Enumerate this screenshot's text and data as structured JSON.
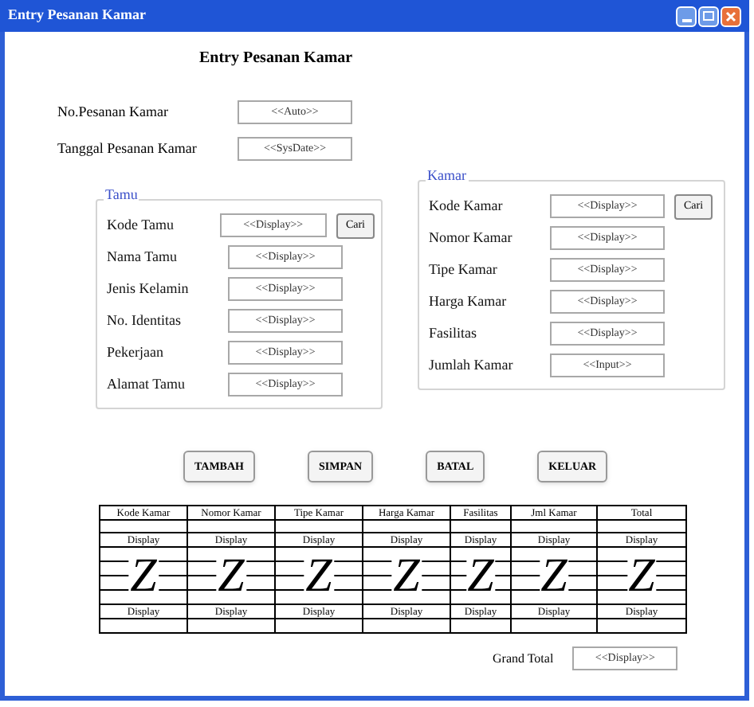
{
  "window": {
    "title": "Entry Pesanan Kamar",
    "controls": [
      {
        "kind": "minimize"
      },
      {
        "kind": "maximize"
      },
      {
        "kind": "close"
      }
    ]
  },
  "heading": "Entry Pesanan Kamar",
  "top_fields": [
    {
      "label": "No.Pesanan Kamar",
      "value": "<<Auto>>"
    },
    {
      "label": "Tanggal Pesanan Kamar",
      "value": "<<SysDate>>"
    }
  ],
  "groups": [
    {
      "title": "Tamu",
      "fields": [
        {
          "label": "Kode Tamu",
          "value": "<<Display>>",
          "button": "Cari"
        },
        {
          "label": "Nama Tamu",
          "value": "<<Display>>"
        },
        {
          "label": "Jenis Kelamin",
          "value": "<<Display>>"
        },
        {
          "label": "No. Identitas",
          "value": "<<Display>>"
        },
        {
          "label": "Pekerjaan",
          "value": "<<Display>>"
        },
        {
          "label": "Alamat Tamu",
          "value": "<<Display>>"
        }
      ]
    },
    {
      "title": "Kamar",
      "fields": [
        {
          "label": "Kode Kamar",
          "value": "<<Display>>",
          "button": "Cari"
        },
        {
          "label": "Nomor Kamar",
          "value": "<<Display>>"
        },
        {
          "label": "Tipe Kamar",
          "value": "<<Display>>"
        },
        {
          "label": "Harga Kamar",
          "value": "<<Display>>"
        },
        {
          "label": "Fasilitas",
          "value": "<<Display>>"
        },
        {
          "label": "Jumlah Kamar",
          "value": "<<Input>>"
        }
      ]
    }
  ],
  "buttons": [
    "TAMBAH",
    "SIMPAN",
    "BATAL",
    "KELUAR"
  ],
  "table": {
    "columns": [
      {
        "header": "Kode Kamar",
        "top": "Display",
        "mark": "Z",
        "bottom": "Display"
      },
      {
        "header": "Nomor Kamar",
        "top": "Display",
        "mark": "Z",
        "bottom": "Display"
      },
      {
        "header": "Tipe Kamar",
        "top": "Display",
        "mark": "Z",
        "bottom": "Display"
      },
      {
        "header": "Harga Kamar",
        "top": "Display",
        "mark": "Z",
        "bottom": "Display"
      },
      {
        "header": "Fasilitas",
        "top": "Display",
        "mark": "Z",
        "bottom": "Display"
      },
      {
        "header": "Jml Kamar",
        "top": "Display",
        "mark": "Z",
        "bottom": "Display"
      },
      {
        "header": "Total",
        "top": "Display",
        "mark": "Z",
        "bottom": "Display"
      }
    ]
  },
  "grand_total": {
    "label": "Grand Total",
    "value": "<<Display>>"
  }
}
